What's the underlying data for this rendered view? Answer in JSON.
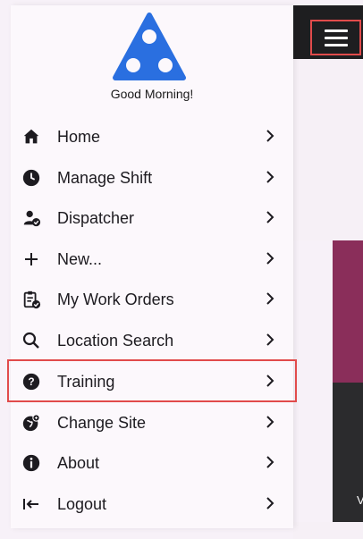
{
  "drawer": {
    "greeting": "Good Morning!",
    "items": [
      {
        "label": "Home",
        "icon": "home-icon"
      },
      {
        "label": "Manage Shift",
        "icon": "clock-icon"
      },
      {
        "label": "Dispatcher",
        "icon": "dispatcher-icon"
      },
      {
        "label": "New...",
        "icon": "plus-icon"
      },
      {
        "label": "My Work Orders",
        "icon": "work-orders-icon"
      },
      {
        "label": "Location Search",
        "icon": "search-icon"
      },
      {
        "label": "Training",
        "icon": "help-circle-icon"
      },
      {
        "label": "Change Site",
        "icon": "change-site-icon"
      },
      {
        "label": "About",
        "icon": "info-icon"
      },
      {
        "label": "Logout",
        "icon": "logout-icon"
      }
    ]
  },
  "background": {
    "peek_text": "V"
  },
  "colors": {
    "logo_blue": "#2a6fe0",
    "highlight_border": "#e14b4b",
    "maroon_panel": "#8a2e5a",
    "dark_panel": "#2b2b2d"
  }
}
